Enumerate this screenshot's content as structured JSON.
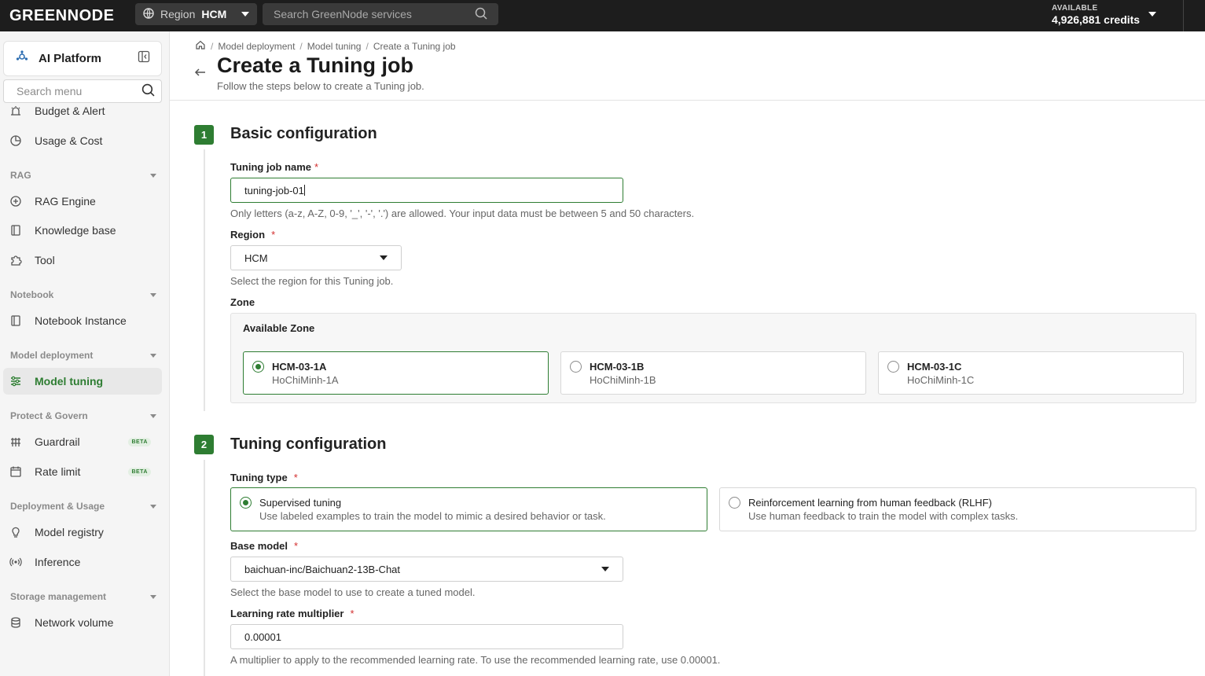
{
  "topbar": {
    "logo": "GREENNODE",
    "region_label": "Region",
    "region_value": "HCM",
    "search_placeholder": "Search GreenNode services",
    "credits_label": "AVAILABLE",
    "credits_value": "4,926,881 credits"
  },
  "sidebar": {
    "platform_title": "AI Platform",
    "search_placeholder": "Search menu",
    "items": {
      "budget": "Budget & Alert",
      "usage": "Usage & Cost",
      "rag_engine": "RAG Engine",
      "knowledge_base": "Knowledge base",
      "tool": "Tool",
      "notebook_instance": "Notebook Instance",
      "model_tuning": "Model tuning",
      "guardrail": "Guardrail",
      "rate_limit": "Rate limit",
      "model_registry": "Model registry",
      "inference": "Inference",
      "network_volume": "Network volume"
    },
    "groups": {
      "rag": "RAG",
      "notebook": "Notebook",
      "model_deployment": "Model deployment",
      "protect": "Protect & Govern",
      "deployment_usage": "Deployment & Usage",
      "storage": "Storage management"
    },
    "beta_badge": "BETA"
  },
  "breadcrumb": {
    "items": [
      "Model deployment",
      "Model tuning",
      "Create a Tuning job"
    ],
    "separator": "/"
  },
  "page": {
    "title": "Create a Tuning job",
    "subtitle": "Follow the steps below to create a Tuning job."
  },
  "step1": {
    "number": "1",
    "title": "Basic configuration",
    "job_name_label": "Tuning job name",
    "job_name_value": "tuning-job-01",
    "job_name_help": "Only letters (a-z, A-Z, 0-9, '_', '-', '.') are allowed. Your input data must be between 5 and 50 characters.",
    "region_label": "Region",
    "region_value": "HCM",
    "region_help": "Select the region for this Tuning job.",
    "zone_label": "Zone",
    "zone_box_title": "Available Zone",
    "zones": [
      {
        "code": "HCM-03-1A",
        "name": "HoChiMinh-1A",
        "selected": true
      },
      {
        "code": "HCM-03-1B",
        "name": "HoChiMinh-1B",
        "selected": false
      },
      {
        "code": "HCM-03-1C",
        "name": "HoChiMinh-1C",
        "selected": false
      }
    ]
  },
  "step2": {
    "number": "2",
    "title": "Tuning configuration",
    "tuning_type_label": "Tuning type",
    "tuning_types": [
      {
        "title": "Supervised tuning",
        "desc": "Use labeled examples to train the model to mimic a desired behavior or task.",
        "selected": true
      },
      {
        "title": "Reinforcement learning from human feedback (RLHF)",
        "desc": "Use human feedback to train the model with complex tasks.",
        "selected": false
      }
    ],
    "base_model_label": "Base model",
    "base_model_value": "baichuan-inc/Baichuan2-13B-Chat",
    "base_model_help": "Select the base model to use to create a tuned model.",
    "lr_label": "Learning rate multiplier",
    "lr_value": "0.00001",
    "lr_help": "A multiplier to apply to the recommended learning rate. To use the recommended learning rate, use 0.00001."
  },
  "required_marker": "*",
  "colors": {
    "accent": "#2e7d32",
    "topbar": "#1d1d1d",
    "required": "#d32f2f"
  }
}
